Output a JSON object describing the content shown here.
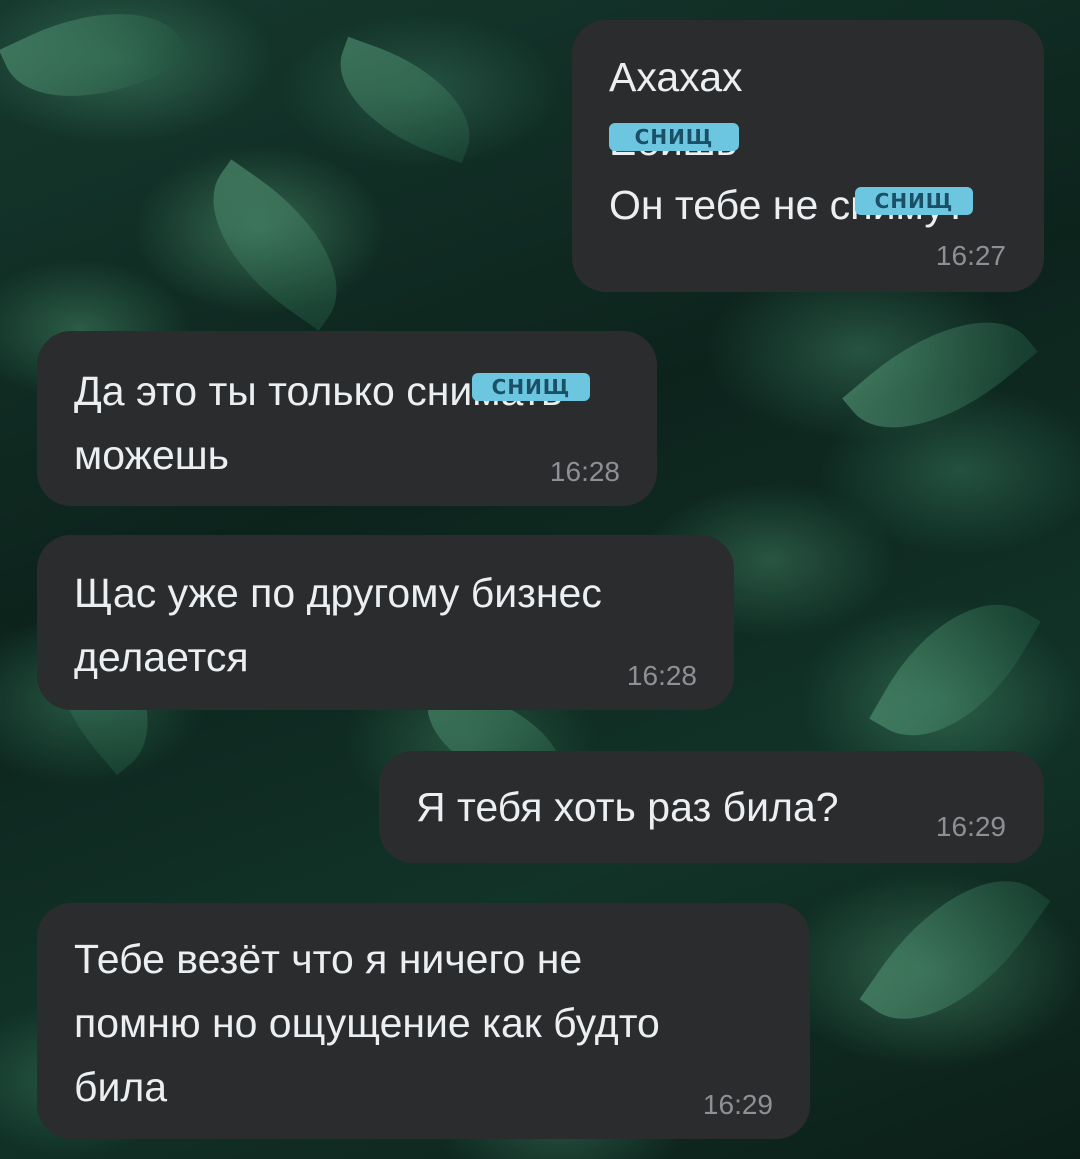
{
  "messages": [
    {
      "side": "outgoing",
      "lines": [
        "Ахахах",
        "Ебишь",
        "Он тебе не сниму?"
      ],
      "time": "16:27"
    },
    {
      "side": "incoming",
      "lines": [
        "Да это ты только снимать",
        "можешь"
      ],
      "time": "16:28"
    },
    {
      "side": "incoming",
      "lines": [
        "Щас уже по другому бизнес",
        "делается"
      ],
      "time": "16:28"
    },
    {
      "side": "outgoing",
      "lines": [
        "Я тебя хоть раз била?"
      ],
      "time": "16:29"
    },
    {
      "side": "incoming",
      "lines": [
        "Тебе везёт что я ничего не",
        "помню но ощущение как будто",
        "била"
      ],
      "time": "16:29"
    }
  ],
  "censor_sticker_text": "СНИЩ",
  "colors": {
    "bubble": "#2b2c2e",
    "text": "#eceff1",
    "time": "#8d9094",
    "sticker": "#6cc6e0"
  }
}
